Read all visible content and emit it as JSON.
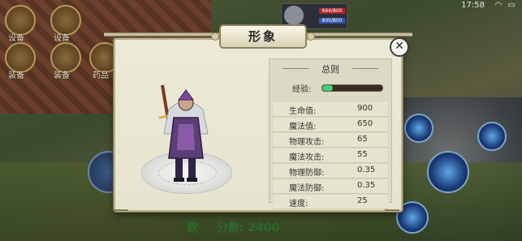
{
  "status_bar": {
    "time": "17:58"
  },
  "hud": {
    "top_buttons": [
      {
        "label": "设备"
      },
      {
        "label": "设备"
      },
      {
        "label": "装备"
      },
      {
        "label": "装备"
      },
      {
        "label": "药品"
      }
    ],
    "hp_text": "664/800",
    "mp_text": "800/800",
    "score_label": "数",
    "score_label2": "分数:",
    "score_value": "2400"
  },
  "dialog": {
    "title": "形象",
    "close_symbol": "✕",
    "stats_title": "总则",
    "exp_label": "经验:",
    "exp_progress": 0.18,
    "stats": [
      {
        "name": "生命值:",
        "value": "900"
      },
      {
        "name": "魔法值:",
        "value": "650"
      },
      {
        "name": "物理攻击:",
        "value": "65"
      },
      {
        "name": "魔法攻击:",
        "value": "55"
      },
      {
        "name": "物理防御:",
        "value": "0.35"
      },
      {
        "name": "魔法防御:",
        "value": "0.35"
      },
      {
        "name": "速度:",
        "value": "25"
      }
    ]
  },
  "colors": {
    "exp_fill": "#41d07a",
    "dialog_bg": "#ecead7",
    "panel_bg": "#dcd9c4"
  }
}
